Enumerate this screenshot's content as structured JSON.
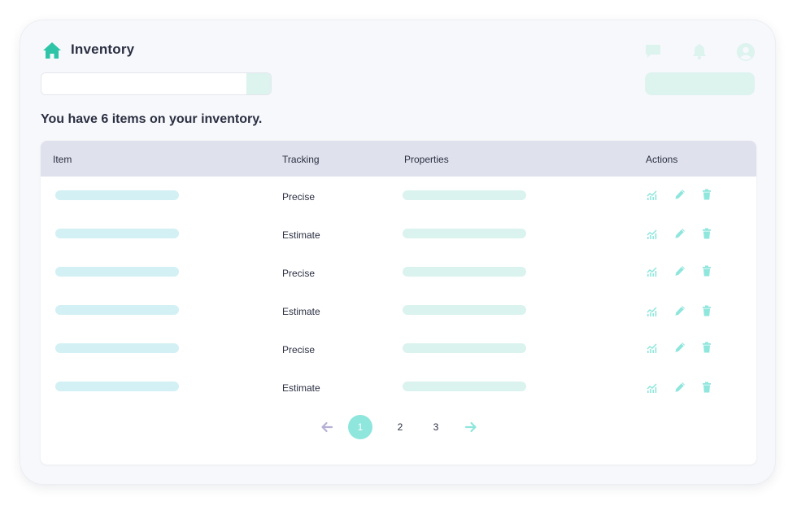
{
  "header": {
    "title": "Inventory",
    "icons": [
      "home-icon",
      "chat-icon",
      "bell-icon",
      "user-avatar-icon"
    ]
  },
  "search": {
    "value": "",
    "placeholder": ""
  },
  "summary": "You have 6 items on your inventory.",
  "table": {
    "columns": [
      "Item",
      "Tracking",
      "Properties",
      "Actions"
    ],
    "rows": [
      {
        "tracking": "Precise"
      },
      {
        "tracking": "Estimate"
      },
      {
        "tracking": "Precise"
      },
      {
        "tracking": "Estimate"
      },
      {
        "tracking": "Precise"
      },
      {
        "tracking": "Estimate"
      }
    ],
    "row_actions": [
      "chart-icon",
      "pencil-icon",
      "trash-icon"
    ]
  },
  "pagination": {
    "pages": [
      "1",
      "2",
      "3"
    ],
    "current": "1"
  },
  "colors": {
    "accent": "#2ec4a8",
    "accent_light": "#dcf3ee",
    "header_bg": "#dfe1ec",
    "text": "#2b2f42",
    "active_page": "#8fe6dc"
  }
}
